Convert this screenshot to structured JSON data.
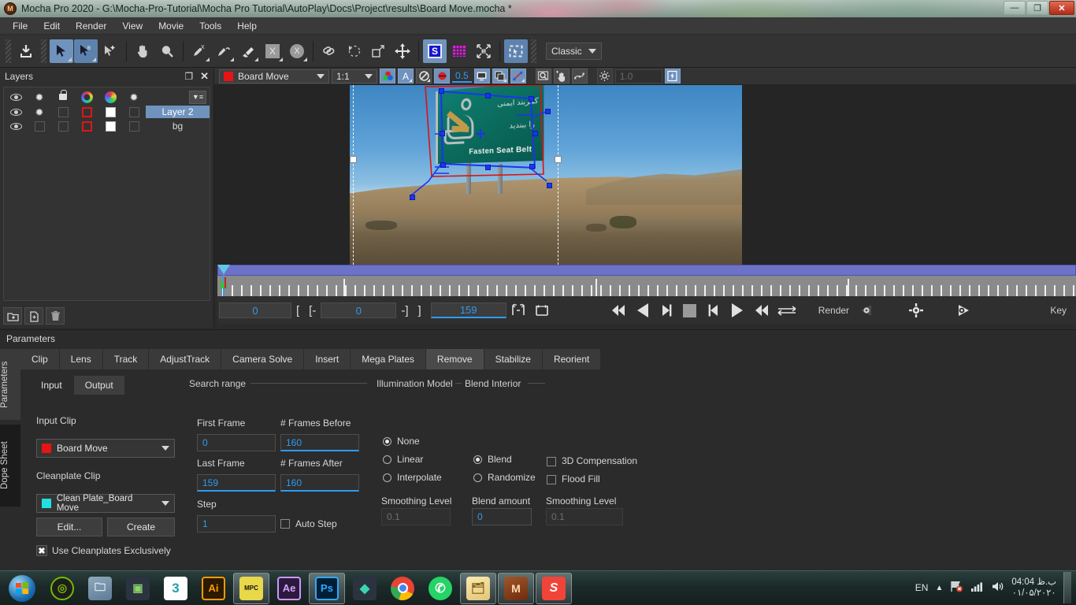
{
  "window": {
    "title": "Mocha Pro 2020 - G:\\Mocha-Pro-Tutorial\\Mocha Pro Tutorial\\AutoPlay\\Docs\\Project\\results\\Board Move.mocha *",
    "minimize": "—",
    "restore": "❐",
    "close": "✕"
  },
  "menubar": {
    "items": [
      "File",
      "Edit",
      "Render",
      "View",
      "Movie",
      "Tools",
      "Help"
    ]
  },
  "toolbar": {
    "icons": [
      "import-icon",
      "select-tool-icon",
      "select-b-tool-icon",
      "add-point-tool-icon",
      "pan-hand-icon",
      "zoom-magnifier-icon",
      "xspline-pen-icon",
      "bezier-pen-icon",
      "brush-icon",
      "x-matte-icon",
      "x-circle-icon",
      "link-icon",
      "mesh-icon",
      "corner-pin-icon",
      "move-icon",
      "surface-icon",
      "grid-icon",
      "stabilize-icon",
      "roi-icon"
    ],
    "layout_dropdown": "Classic"
  },
  "layers": {
    "panel_title": "Layers",
    "header_icons": [
      "eye-icon",
      "gear-icon",
      "lock-icon",
      "outline-color-icon",
      "fill-color-icon",
      "gear-icon"
    ],
    "menu_icon": "layer-menu-icon",
    "rows": [
      {
        "name": "Layer 2",
        "selected": true,
        "visible": true,
        "gear": true,
        "locked": false,
        "outline_color": "#e11515",
        "fill_color": "#ffffff"
      },
      {
        "name": "bg",
        "selected": false,
        "visible": true,
        "gear": false,
        "locked": false,
        "outline_color": "#e11515",
        "fill_color": "#ffffff"
      }
    ],
    "footer_buttons": [
      "add-layer-icon",
      "duplicate-layer-icon",
      "delete-layer-icon"
    ]
  },
  "viewer_toolbar": {
    "clip_name": "Board Move",
    "clip_color": "#e81313",
    "zoom_level": "1:1",
    "opacity_value": "0.5",
    "light_value": "1.0",
    "buttons": [
      "channels-icon",
      "alpha-icon",
      "matte-icon",
      "overlay-icon",
      "monitor-icon",
      "layers-stack-icon",
      "curve-icon",
      "magnify-region-icon",
      "hand-nudge-icon",
      "spline-points-icon",
      "brightness-icon",
      "gpu-icon"
    ]
  },
  "viewer": {
    "billboard": {
      "text_english": "Fasten Seat Belt",
      "text_farsi_top": "کمربند ایمنی",
      "text_farsi_bottom": "را ببندید"
    }
  },
  "transport": {
    "current_frame": "0",
    "in_bracket": "[",
    "in_frame_label": "[-",
    "in_frame": "0",
    "out_frame_label": "-]",
    "out_bracket": "]",
    "last_frame": "159",
    "buttons": [
      "first-frame-icon",
      "play-backward-icon",
      "step-back-icon",
      "stop-icon",
      "step-forward-icon",
      "play-forward-icon",
      "last-frame-icon",
      "loop-icon"
    ],
    "render_label": "Render",
    "render_icon": "render-gear-icon",
    "settings_icon": "settings-gear-icon",
    "preview_icon": "preview-gear-icon",
    "key_label": "Key",
    "trim_icons": [
      "trim-in-out-icon",
      "trim-range-icon"
    ]
  },
  "parameters": {
    "title": "Parameters",
    "vertical_tabs": [
      "Parameters",
      "Dope Sheet"
    ],
    "tabs": [
      "Clip",
      "Lens",
      "Track",
      "AdjustTrack",
      "Camera Solve",
      "Insert",
      "Mega Plates",
      "Remove",
      "Stabilize",
      "Reorient"
    ],
    "selected_tab": "Remove",
    "subtabs": [
      "Input",
      "Output"
    ],
    "selected_subtab": "Output",
    "group_labels": {
      "search_range": "Search range",
      "illumination_model": "Illumination Model",
      "blend_interior": "Blend Interior"
    },
    "input_clip": {
      "label": "Input Clip",
      "value": "Board Move",
      "color": "#e81313"
    },
    "cleanplate_clip": {
      "label": "Cleanplate Clip",
      "value": "Clean Plate_Board Move",
      "color": "#23e0e0",
      "edit_button": "Edit...",
      "create_button": "Create",
      "exclusive_label": "Use Cleanplates Exclusively",
      "exclusive_checked": true
    },
    "search_range": {
      "first_frame_label": "First Frame",
      "first_frame_value": "0",
      "frames_before_label": "# Frames Before",
      "frames_before_value": "160",
      "last_frame_label": "Last Frame",
      "last_frame_value": "159",
      "frames_after_label": "# Frames After",
      "frames_after_value": "160",
      "step_label": "Step",
      "step_value": "1",
      "auto_step_label": "Auto Step",
      "auto_step_checked": false
    },
    "illumination": {
      "options": [
        "None",
        "Linear",
        "Interpolate"
      ],
      "selected": "None",
      "smoothing_label": "Smoothing Level",
      "smoothing_value": "0.1",
      "smoothing_disabled": true
    },
    "blend": {
      "options": [
        "Blend",
        "Randomize"
      ],
      "selected": "Blend",
      "amount_label": "Blend amount",
      "amount_value": "0"
    },
    "blend_interior": {
      "compensation_label": "3D Compensation",
      "compensation_checked": false,
      "flood_fill_label": "Flood Fill",
      "flood_fill_checked": false,
      "smoothing_label": "Smoothing Level",
      "smoothing_value": "0.1",
      "smoothing_disabled": true
    }
  },
  "taskbar": {
    "start_icon": "windows-start-icon",
    "items": [
      {
        "name": "nvidia-icon",
        "label": "",
        "bg": "#1d1d1d",
        "fg": "#76b900",
        "active": false
      },
      {
        "name": "explorer-icon",
        "label": "",
        "bg": "#4d6a86",
        "fg": "#cfe2f0",
        "active": false
      },
      {
        "name": "media-player-icon",
        "label": "",
        "bg": "#2b3340",
        "fg": "#8ad36a",
        "active": false
      },
      {
        "name": "3ds-max-icon",
        "label": "3",
        "bg": "#ffffff",
        "fg": "#22a0a8",
        "active": false
      },
      {
        "name": "illustrator-icon",
        "label": "Ai",
        "bg": "#2b1a00",
        "fg": "#ff9a00",
        "active": false
      },
      {
        "name": "mpc-player-icon",
        "label": "MPC",
        "bg": "#e8d84a",
        "fg": "#111111",
        "active": true
      },
      {
        "name": "after-effects-icon",
        "label": "Ae",
        "bg": "#2b1a3d",
        "fg": "#d6a3ff",
        "active": false
      },
      {
        "name": "photoshop-icon",
        "label": "Ps",
        "bg": "#001e36",
        "fg": "#31a8ff",
        "active": true
      },
      {
        "name": "filmora-icon",
        "label": "",
        "bg": "#2b3340",
        "fg": "#3ad4b0",
        "active": false
      },
      {
        "name": "chrome-icon",
        "label": "",
        "bg": "#ffffff",
        "fg": "#4285f4",
        "active": false
      },
      {
        "name": "whatsapp-icon",
        "label": "",
        "bg": "#25d366",
        "fg": "#ffffff",
        "active": false
      },
      {
        "name": "folder-icon",
        "label": "",
        "bg": "#f0d88a",
        "fg": "#7a5c10",
        "active": true
      },
      {
        "name": "mocha-pro-icon",
        "label": "M",
        "bg": "#8a3b18",
        "fg": "#ffd9a8",
        "active": true
      },
      {
        "name": "snagit-icon",
        "label": "S",
        "bg": "#f04438",
        "fg": "#ffffff",
        "active": true
      }
    ],
    "language": "EN",
    "tray_icons": [
      "show-hidden-icon",
      "network-error-icon",
      "signal-icon",
      "volume-icon"
    ],
    "time": "04:04 ب.ظ",
    "date": "۰۱/۰۵/۲۰۲۰"
  }
}
